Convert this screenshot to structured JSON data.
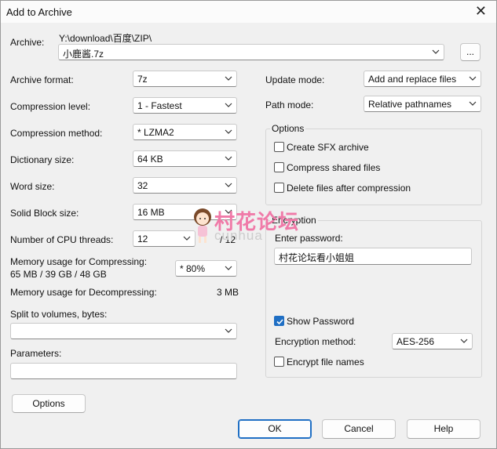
{
  "window": {
    "title": "Add to Archive",
    "close": "✕"
  },
  "archive": {
    "label": "Archive:",
    "path": "Y:\\download\\百度\\ZIP\\",
    "name": "小鹿酱.7z",
    "browse": "..."
  },
  "left": {
    "format": {
      "label": "Archive format:",
      "value": "7z"
    },
    "level": {
      "label": "Compression level:",
      "value": "1 - Fastest"
    },
    "method": {
      "label": "Compression method:",
      "value": "*  LZMA2"
    },
    "dict": {
      "label": "Dictionary size:",
      "value": "64 KB"
    },
    "word": {
      "label": "Word size:",
      "value": "32"
    },
    "solid": {
      "label": "Solid Block size:",
      "value": "16 MB"
    },
    "threads": {
      "label": "Number of CPU threads:",
      "value": "12",
      "max": "/ 12"
    },
    "mem_comp": {
      "label": "Memory usage for Compressing:",
      "value": "65 MB / 39 GB / 48 GB",
      "percent": "*  80%"
    },
    "mem_decomp": {
      "label": "Memory usage for Decompressing:",
      "value": "3 MB"
    },
    "split": {
      "label": "Split to volumes, bytes:",
      "value": ""
    },
    "params": {
      "label": "Parameters:",
      "value": ""
    },
    "options_btn": "Options"
  },
  "right": {
    "update": {
      "label": "Update mode:",
      "value": "Add and replace files"
    },
    "path_mode": {
      "label": "Path mode:",
      "value": "Relative pathnames"
    },
    "options": {
      "title": "Options",
      "sfx": "Create SFX archive",
      "shared": "Compress shared files",
      "delete": "Delete files after compression"
    },
    "encryption": {
      "title": "Encryption",
      "pw_label": "Enter password:",
      "password": "村花论坛看小姐姐",
      "show": "Show Password",
      "method_label": "Encryption method:",
      "method": "AES-256",
      "names": "Encrypt file names"
    }
  },
  "buttons": {
    "ok": "OK",
    "cancel": "Cancel",
    "help": "Help"
  },
  "watermark": {
    "text": "村花论坛",
    "sub": "cunhua"
  },
  "colors": {
    "accent": "#1f6fc4",
    "watermark": "#f07aa8"
  }
}
